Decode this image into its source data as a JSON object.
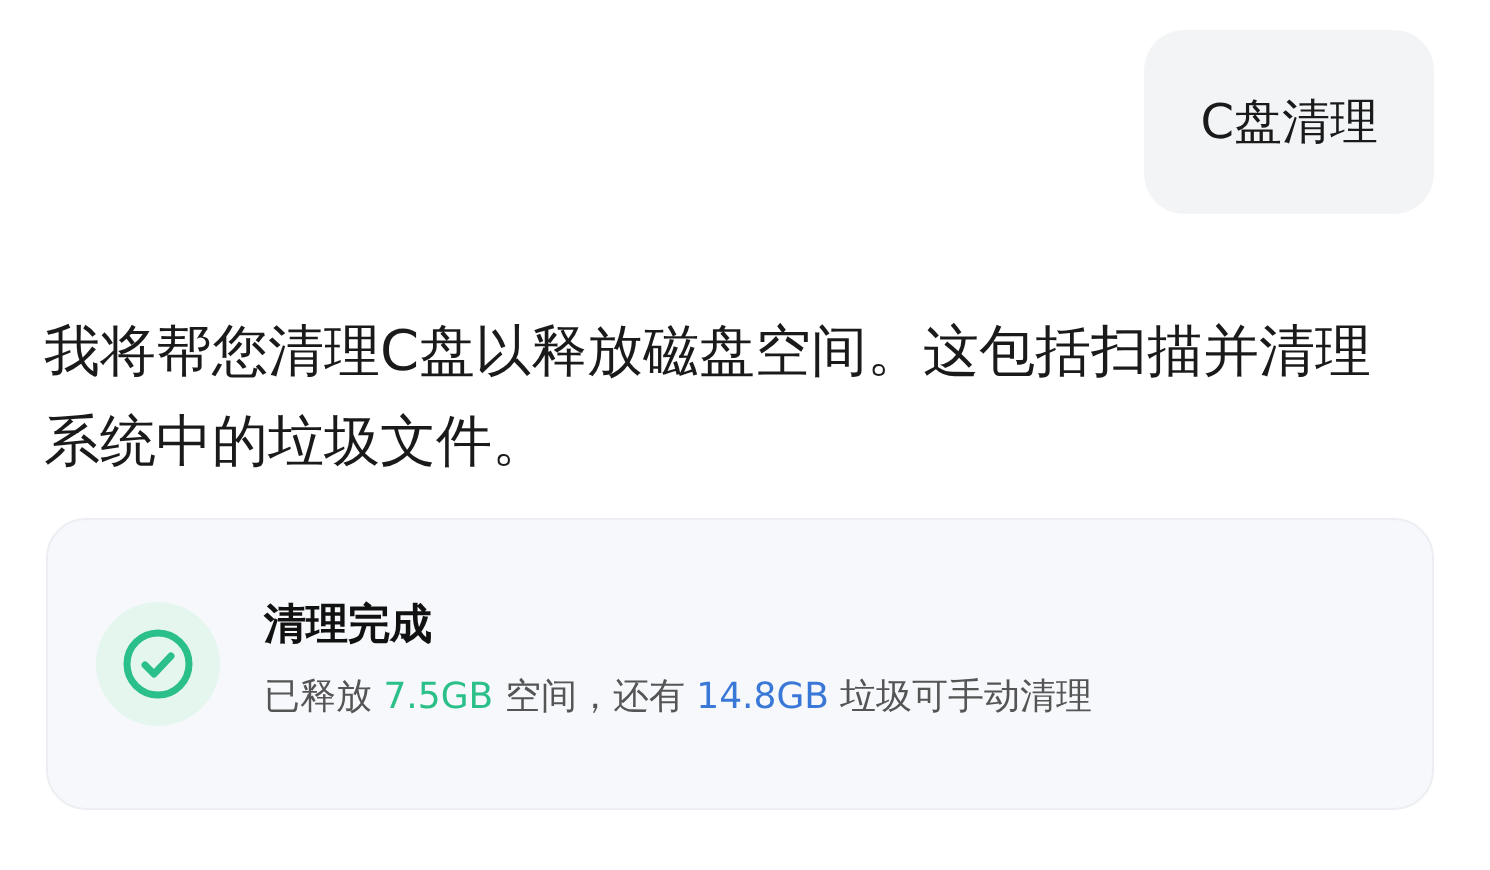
{
  "user_message": {
    "text": "C盘清理"
  },
  "assistant_message": {
    "text": "我将帮您清理C盘以释放磁盘空间。这包括扫描并清理系统中的垃圾文件。"
  },
  "result_card": {
    "done": true,
    "title": "清理完成",
    "detail": [
      {
        "text": "已释放 "
      },
      {
        "text": "7.5GB",
        "color": "#2bbf8a"
      },
      {
        "text": " 空间，还有 "
      },
      {
        "text": "14.8GB",
        "color": "#3a78d8"
      },
      {
        "text": " 垃圾可手动清理"
      }
    ]
  }
}
